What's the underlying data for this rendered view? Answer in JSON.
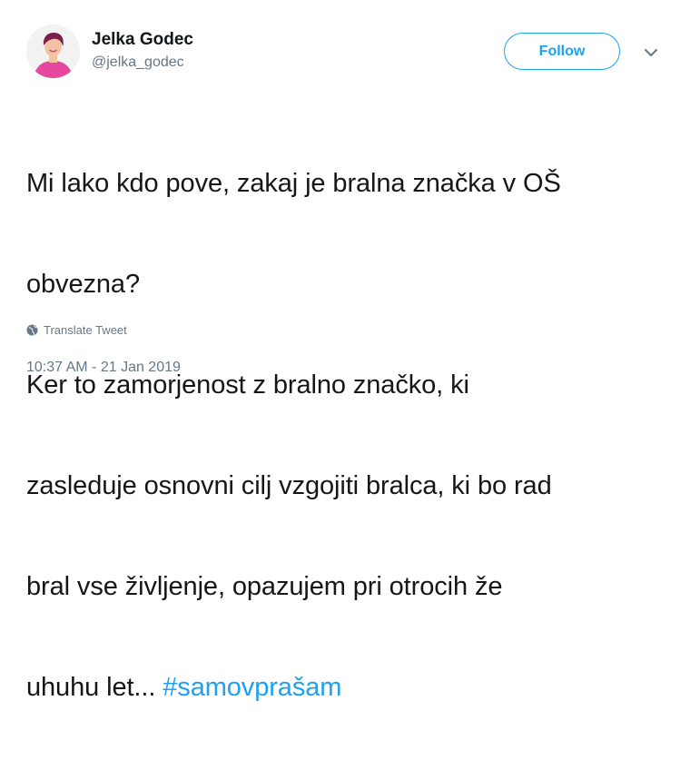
{
  "author": {
    "name": "Jelka Godec",
    "handle": "@jelka_godec",
    "avatar_icon": "profile-photo",
    "avatar_colors": {
      "shirt": "#e8479f",
      "hair": "#7a1f47",
      "skin": "#f2c2a2",
      "background": "#f2f2f2"
    }
  },
  "header": {
    "follow_label": "Follow",
    "caret_icon": "chevron-down-icon"
  },
  "tweet": {
    "lines": [
      "Mi lako kdo pove, zakaj je bralna značka v OŠ",
      "obvezna?",
      "Ker to zamorjenost z bralno značko, ki",
      "zasleduje osnovni cilj vzgojiti bralca, ki bo rad",
      "bral vse življenje, opazujem pri otrocih že",
      "uhuhu let... "
    ],
    "hashtag": "#samovprašam"
  },
  "translate": {
    "label": "Translate Tweet",
    "icon": "globe-icon"
  },
  "timestamp": "10:37 AM - 21 Jan 2019",
  "colors": {
    "accent": "#1da1f2",
    "text": "#14171a",
    "muted": "#657786",
    "background": "#ffffff"
  }
}
